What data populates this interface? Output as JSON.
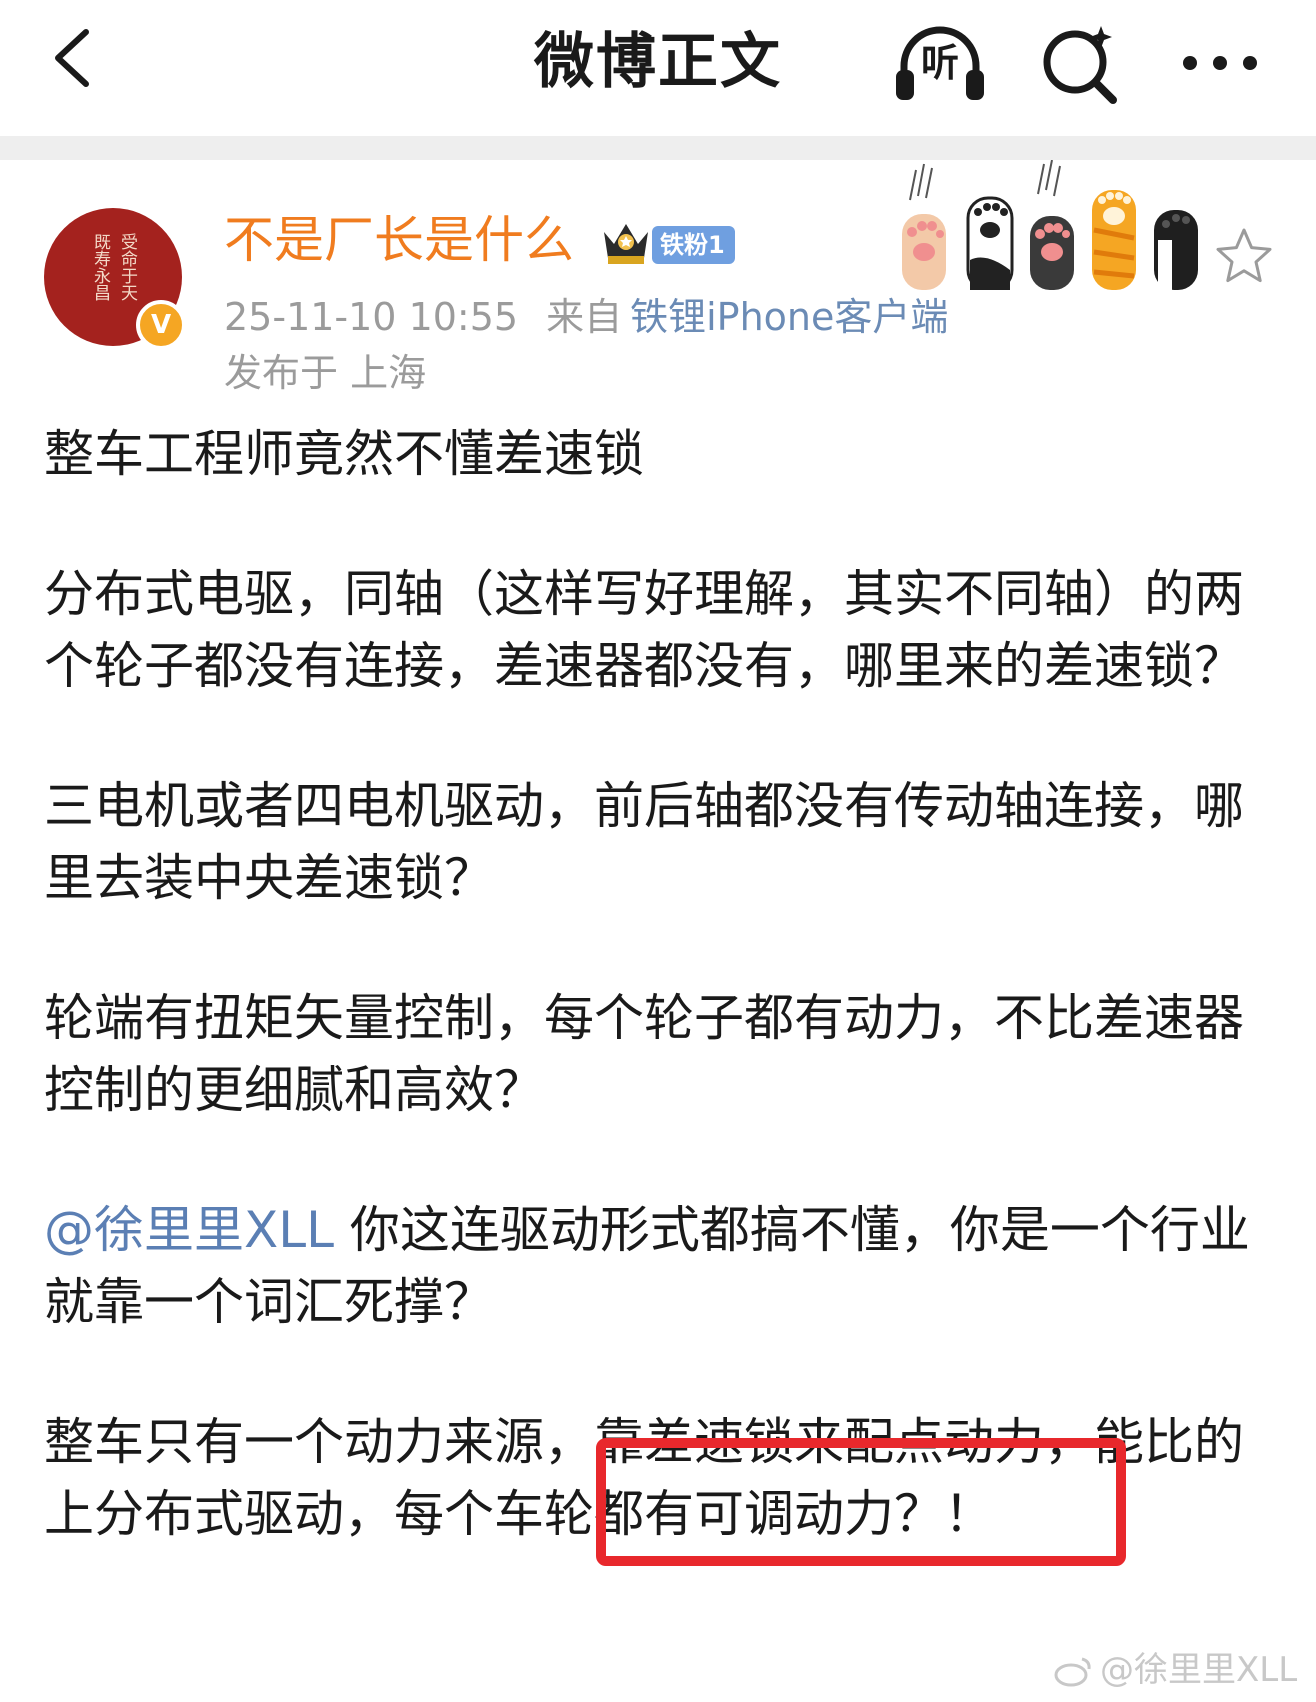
{
  "topbar": {
    "title": "微博正文",
    "listen_label": "听"
  },
  "post": {
    "author": {
      "name": "不是厂长是什么",
      "avatar_text": [
        "受命于天",
        "既寿永昌"
      ],
      "fan_badge": "铁粉1"
    },
    "time": "25-11-10 10:55",
    "from_label": "来自",
    "client": "铁锂iPhone客户端",
    "location": "发布于 上海",
    "paragraphs": [
      "整车工程师竟然不懂差速锁",
      "分布式电驱，同轴（这样写好理解，其实不同轴）的两个轮子都没有连接，差速器都没有，哪里来的差速锁？",
      "三电机或者四电机驱动，前后轴都没有传动轴连接，哪里去装中央差速锁？",
      "轮端有扭矩矢量控制，每个轮子都有动力，不比差速器控制的更细腻和高效？"
    ],
    "mention": "@徐里里XLL",
    "mention_rest": " 你这连驱动形式都搞不懂，你是一个行业就靠一个词汇死撑？",
    "last_para_1": "整车只有一个动力来源，",
    "last_para_highlight": "靠差速锁来配点动力",
    "last_para_2": "，能比的上分布式驱动，每个车轮都有可调动力？！"
  },
  "watermark": "@徐里里XLL",
  "colors": {
    "username": "#f07c1f",
    "mention": "#5b7fb4",
    "meta": "#9b9b9b",
    "highlight_box": "#e8282c",
    "fan_badge": "#6f9fe0",
    "verified": "#f5a623"
  }
}
